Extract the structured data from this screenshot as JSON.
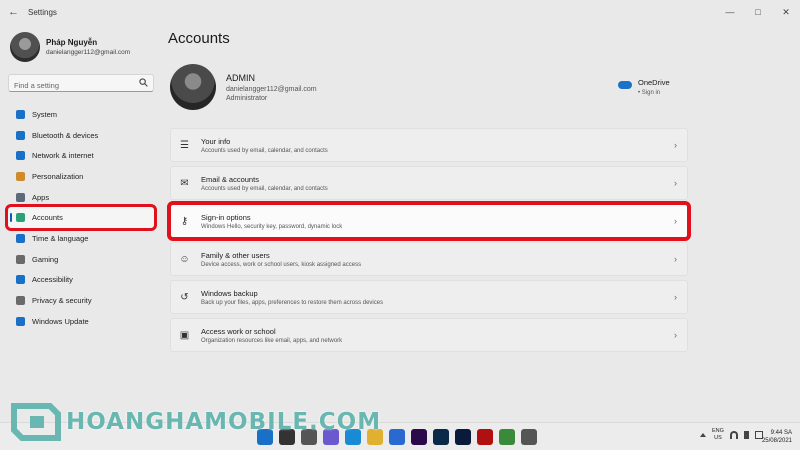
{
  "window": {
    "app_title": "Settings",
    "back_icon": "arrow-left-icon",
    "controls": [
      "minimize-icon",
      "maximize-icon",
      "close-icon"
    ]
  },
  "sidebar": {
    "profile": {
      "name": "Pháp Nguyễn",
      "email": "danielangger112@gmail.com"
    },
    "search": {
      "placeholder": "Find a setting",
      "value": ""
    },
    "items": [
      {
        "label": "System",
        "icon": "monitor-icon",
        "color": "#1a6fc7"
      },
      {
        "label": "Bluetooth & devices",
        "icon": "bluetooth-icon",
        "color": "#1a6fc7"
      },
      {
        "label": "Network & internet",
        "icon": "wifi-icon",
        "color": "#1a6fc7"
      },
      {
        "label": "Personalization",
        "icon": "brush-icon",
        "color": "#d08a2a"
      },
      {
        "label": "Apps",
        "icon": "apps-icon",
        "color": "#5a6a7a"
      },
      {
        "label": "Accounts",
        "icon": "person-icon",
        "color": "#2aa17a",
        "active": true
      },
      {
        "label": "Time & language",
        "icon": "globe-clock-icon",
        "color": "#1a6fc7"
      },
      {
        "label": "Gaming",
        "icon": "gamepad-icon",
        "color": "#6a6a6a"
      },
      {
        "label": "Accessibility",
        "icon": "accessibility-icon",
        "color": "#1a6fc7"
      },
      {
        "label": "Privacy & security",
        "icon": "shield-icon",
        "color": "#6a6a6a"
      },
      {
        "label": "Windows Update",
        "icon": "refresh-icon",
        "color": "#1a6fc7"
      }
    ]
  },
  "main": {
    "title": "Accounts",
    "user": {
      "name": "ADMIN",
      "email": "danielangger112@gmail.com",
      "role": "Administrator"
    },
    "onedrive": {
      "label": "OneDrive",
      "status": "• Sign in"
    },
    "cards": [
      {
        "title": "Your info",
        "desc": "Accounts used by email, calendar, and contacts",
        "icon": "person-card-icon"
      },
      {
        "title": "Email & accounts",
        "desc": "Accounts used by email, calendar, and contacts",
        "icon": "mail-icon"
      },
      {
        "title": "Sign-in options",
        "desc": "Windows Hello, security key, password, dynamic lock",
        "icon": "key-icon",
        "highlight": true
      },
      {
        "title": "Family & other users",
        "desc": "Device access, work or school users, kiosk assigned access",
        "icon": "people-icon"
      },
      {
        "title": "Windows backup",
        "desc": "Back up your files, apps, preferences to restore them across devices",
        "icon": "backup-icon"
      },
      {
        "title": "Access work or school",
        "desc": "Organization resources like email, apps, and network",
        "icon": "briefcase-icon"
      }
    ]
  },
  "taskbar": {
    "apps": [
      "windows-start-icon",
      "search-icon",
      "task-view-icon",
      "chat-icon",
      "edge-icon",
      "file-explorer-icon",
      "store-icon",
      "premiere-icon",
      "lightroom-icon",
      "photoshop-icon",
      "acrobat-icon",
      "app-icon",
      "settings-icon"
    ],
    "lang_top": "ENG",
    "lang_bottom": "US",
    "time": "9:44 SA",
    "date": "25/08/2021"
  },
  "watermark": {
    "text": "HOANGHAMOBILE.COM"
  },
  "colors": {
    "highlight": "#e0101c",
    "accent": "#0b5cb7",
    "watermark": "#5fb3ad"
  }
}
